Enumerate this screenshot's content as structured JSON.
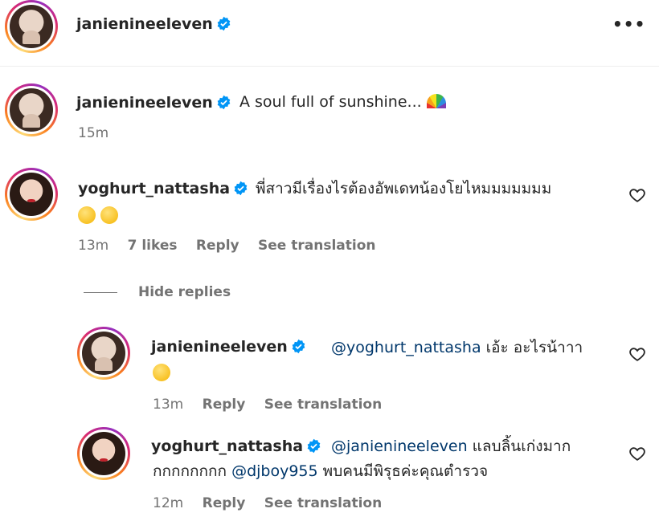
{
  "header": {
    "username": "janienineeleven",
    "more_label": "•••"
  },
  "caption": {
    "username": "janienineeleven",
    "text": "A soul full of sunshine...",
    "emoji": "rainbow-emoji",
    "time": "15m"
  },
  "comments": [
    {
      "username": "yoghurt_nattasha",
      "text_line1": "พี่สาวมีเรื่องไรต้องอัพเดทน้องโยไหมมมมมมม",
      "time": "13m",
      "likes": "7 likes",
      "reply": "Reply",
      "translate": "See translation"
    }
  ],
  "hide_replies": "Hide replies",
  "replies": [
    {
      "username": "janienineeleven",
      "mention": "@yoghurt_nattasha",
      "text": "เอ้ะ อะไรน้าาา",
      "time": "13m",
      "reply": "Reply",
      "translate": "See translation"
    },
    {
      "username": "yoghurt_nattasha",
      "mention1": "@janienineeleven",
      "text1": "แลบลิ้นเก่งมาก",
      "text2": "กกกกกกกก",
      "mention2": "@djboy955",
      "text3": "พบคนมีพิรุธค่ะคุณตำรวจ",
      "time": "12m",
      "reply": "Reply",
      "translate": "See translation"
    }
  ],
  "colors": {
    "verified": "#0095f6",
    "mention": "#00376b",
    "meta": "#737373"
  }
}
